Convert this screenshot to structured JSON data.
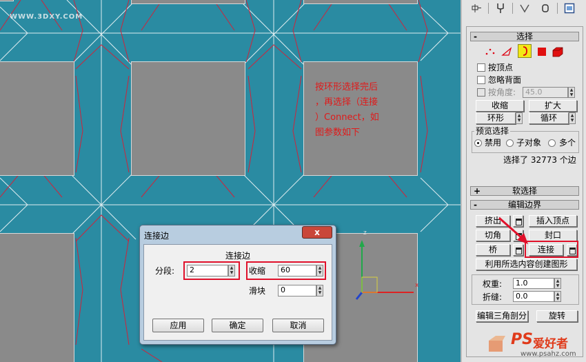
{
  "viewport": {
    "watermark": "WWW.3DXY.COM",
    "annotation": [
      "按环形选择完后",
      "，再选择（连接",
      "）Connect，如",
      "图参数如下"
    ]
  },
  "toolbar": {
    "icons": [
      "pin-icon",
      "fork-icon",
      "curve-icon",
      "hammer-icon",
      "display-icon"
    ]
  },
  "select_rollout": {
    "sign": "-",
    "title": "选择",
    "by_vertex_label": "按顶点",
    "ignore_backfacing_label": "忽略背面",
    "by_angle_label": "按角度:",
    "by_angle_value": "45.0",
    "shrink_label": "收缩",
    "grow_label": "扩大",
    "ring_label": "环形",
    "loop_label": "循环",
    "preview_group": "预览选择",
    "preview_options": [
      "禁用",
      "子对象",
      "多个"
    ],
    "status": "选择了 32773 个边"
  },
  "soft_select_rollout": {
    "sign": "+",
    "title": "软选择"
  },
  "edit_edges_rollout": {
    "sign": "-",
    "title": "编辑边界",
    "extrude_label": "挤出",
    "insert_vertex_label": "插入顶点",
    "chamfer_label": "切角",
    "cap_label": "封口",
    "bridge_label": "桥",
    "connect_label": "连接",
    "create_shape_label": "利用所选内容创建图形",
    "weight_label": "权重:",
    "weight_value": "1.0",
    "crease_label": "折缝:",
    "crease_value": "0.0",
    "edit_tri_label": "编辑三角剖分",
    "turn_label": "旋转"
  },
  "dialog": {
    "title": "连接边",
    "close_label": "x",
    "group_title": "连接边",
    "segments_label": "分段:",
    "segments_value": "2",
    "pinch_label": "收缩",
    "pinch_value": "60",
    "slide_label": "滑块",
    "slide_value": "0",
    "apply_label": "应用",
    "ok_label": "确定",
    "cancel_label": "取消"
  },
  "logo": {
    "ps": "PS",
    "cn": "爱好者",
    "url": "www.psahz.com"
  },
  "colors": {
    "viewport_bg": "#2a8ba2",
    "highlight": "#e0102a",
    "annotation": "#e01a1a"
  }
}
